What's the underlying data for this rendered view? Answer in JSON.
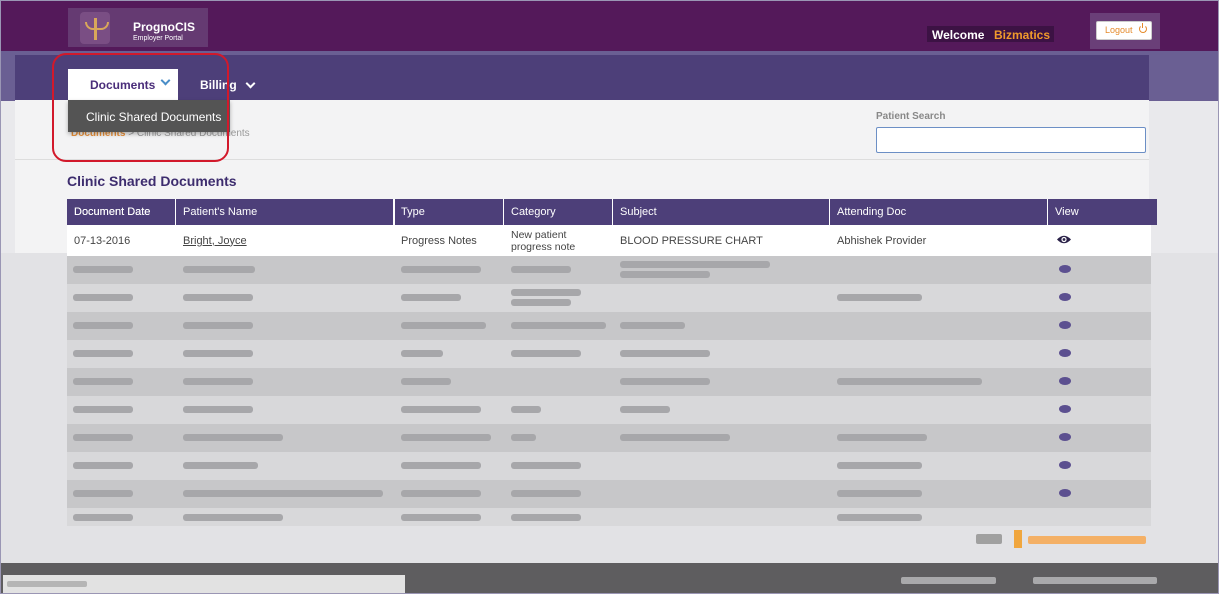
{
  "app": {
    "name": "PrognoCIS",
    "subtitle": "Employer Portal"
  },
  "header": {
    "welcome_label": "Welcome",
    "user_name": "Bizmatics",
    "logout_label": "Logout"
  },
  "nav": {
    "documents_label": "Documents",
    "billing_label": "Billing",
    "dropdown_items": [
      "Clinic Shared Documents"
    ]
  },
  "breadcrumb": {
    "root": "Documents",
    "separator": ">",
    "current": "Clinic Shared Documents"
  },
  "search": {
    "label": "Patient Search",
    "value": "",
    "placeholder": ""
  },
  "page": {
    "title": "Clinic Shared Documents"
  },
  "table": {
    "columns": [
      "Document Date",
      "Patient's Name",
      "Type",
      "Category",
      "Subject",
      "Attending Doc",
      "View"
    ],
    "rows": [
      {
        "document_date": "07-13-2016",
        "patient_name": "Bright, Joyce",
        "type": "Progress Notes",
        "category": "New patient progress note",
        "subject": "BLOOD PRESSURE CHART",
        "attending_doc": "Abhishek Provider"
      }
    ]
  },
  "icons": {
    "view": "eye-icon",
    "logout": "power-icon",
    "logo": "caduceus-icon",
    "dropdown": "chevron-down-icon"
  },
  "colors": {
    "header_bg": "#54195a",
    "nav_bg": "#4d3f79",
    "accent_orange": "#f09a2c",
    "highlight_red": "#d2192b"
  }
}
